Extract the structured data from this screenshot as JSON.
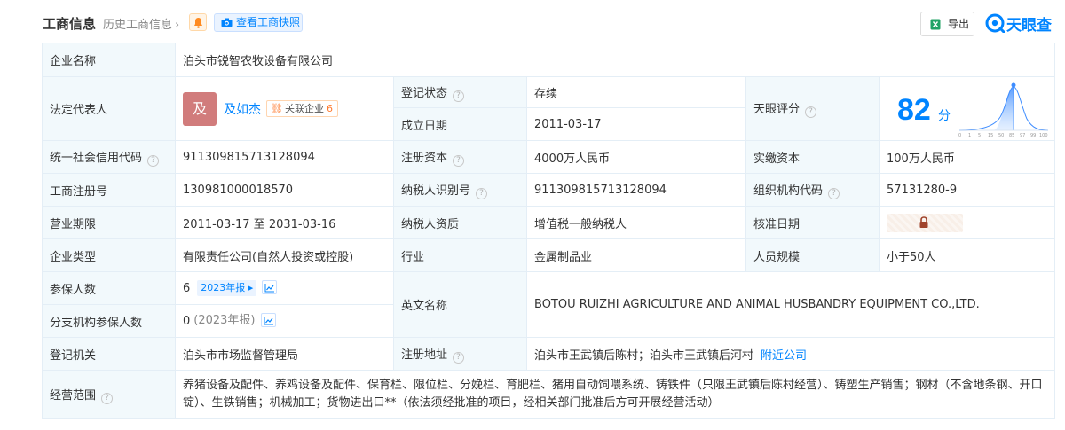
{
  "header": {
    "title": "工商信息",
    "history_link": "历史工商信息",
    "history_chevron": "chevron-right-icon",
    "snapshot_button": "查看工商快照",
    "export_button": "导出",
    "logo_text": "天眼查"
  },
  "rows": {
    "company_name": {
      "label": "企业名称",
      "value": "泊头市锐智农牧设备有限公司"
    },
    "legal_rep": {
      "label": "法定代表人",
      "avatar": "及",
      "name": "及如杰",
      "related_label": "关联企业",
      "related_count": "6"
    },
    "reg_status": {
      "label": "登记状态",
      "value": "存续"
    },
    "founded": {
      "label": "成立日期",
      "value": "2011-03-17"
    },
    "tianyan_score": {
      "label": "天眼评分",
      "value": "82",
      "unit": "分",
      "axis": [
        "0",
        "1",
        "5",
        "15",
        "50",
        "85",
        "97",
        "99",
        "100"
      ]
    },
    "credit_code": {
      "label": "统一社会信用代码",
      "value": "911309815713128094"
    },
    "reg_capital": {
      "label": "注册资本",
      "value": "4000万人民币"
    },
    "paid_capital": {
      "label": "实缴资本",
      "value": "100万人民币"
    },
    "reg_number": {
      "label": "工商注册号",
      "value": "130981000018570"
    },
    "taxpayer_id": {
      "label": "纳税人识别号",
      "value": "911309815713128094"
    },
    "org_code": {
      "label": "组织机构代码",
      "value": "57131280-9"
    },
    "business_term": {
      "label": "营业期限",
      "value": "2011-03-17 至 2031-03-16"
    },
    "taxpayer_qual": {
      "label": "纳税人资质",
      "value": "增值税一般纳税人"
    },
    "approval_date": {
      "label": "核准日期",
      "value": ""
    },
    "company_type": {
      "label": "企业类型",
      "value": "有限责任公司(自然人投资或控股)"
    },
    "industry": {
      "label": "行业",
      "value": "金属制品业"
    },
    "staff_size": {
      "label": "人员规模",
      "value": "小于50人"
    },
    "insured": {
      "label": "参保人数",
      "value": "6",
      "year_tag": "2023年报"
    },
    "english_name": {
      "label": "英文名称",
      "value": "BOTOU RUIZHI AGRICULTURE AND ANIMAL HUSBANDRY EQUIPMENT CO.,LTD."
    },
    "branch_insured": {
      "label": "分支机构参保人数",
      "value": "0",
      "year_tag": "(2023年报)"
    },
    "reg_authority": {
      "label": "登记机关",
      "value": "泊头市市场监督管理局"
    },
    "reg_address": {
      "label": "注册地址",
      "value": "泊头市王武镇后陈村；泊头市王武镇后河村",
      "nearby_link": "附近公司"
    },
    "business_scope": {
      "label": "经营范围",
      "value": "养猪设备及配件、养鸡设备及配件、保育栏、限位栏、分娩栏、育肥栏、猪用自动饲喂系统、铸铁件（只限王武镇后陈村经营）、铸塑生产销售；钢材（不含地条钢、开口锭）、生铁销售；机械加工；货物进出口**（依法须经批准的项目，经相关部门批准后方可开展经营活动）"
    }
  },
  "colors": {
    "accent": "#0084ff",
    "status_green": "#00a03e",
    "label_bg": "#f2f9fc",
    "border": "#e4eef6"
  }
}
